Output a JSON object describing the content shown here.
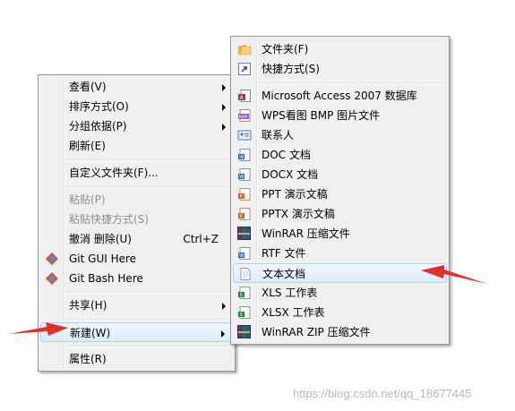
{
  "context_menu": {
    "items": [
      {
        "label": "查看(V)"
      },
      {
        "label": "排序方式(O)"
      },
      {
        "label": "分组依据(P)"
      },
      {
        "label": "刷新(E)"
      },
      {
        "label": "自定义文件夹(F)..."
      },
      {
        "label": "粘贴(P)"
      },
      {
        "label": "粘贴快捷方式(S)"
      },
      {
        "label": "撤消 删除(U)",
        "shortcut": "Ctrl+Z"
      },
      {
        "label": "Git GUI Here"
      },
      {
        "label": "Git Bash Here"
      },
      {
        "label": "共享(H)"
      },
      {
        "label": "新建(W)"
      },
      {
        "label": "属性(R)"
      }
    ]
  },
  "new_submenu": {
    "items": [
      {
        "label": "文件夹(F)",
        "icon": "folder-icon"
      },
      {
        "label": "快捷方式(S)",
        "icon": "shortcut-icon"
      },
      {
        "label": "Microsoft Access 2007 数据库",
        "icon": "access-icon"
      },
      {
        "label": "WPS看图 BMP 图片文件",
        "icon": "bmp-icon"
      },
      {
        "label": "联系人",
        "icon": "contact-icon"
      },
      {
        "label": "DOC 文档",
        "icon": "doc-icon"
      },
      {
        "label": "DOCX 文档",
        "icon": "docx-icon"
      },
      {
        "label": "PPT 演示文稿",
        "icon": "ppt-icon"
      },
      {
        "label": "PPTX 演示文稿",
        "icon": "pptx-icon"
      },
      {
        "label": "WinRAR 压缩文件",
        "icon": "winrar-icon"
      },
      {
        "label": "RTF 文件",
        "icon": "rtf-icon"
      },
      {
        "label": "文本文档",
        "icon": "text-document-icon"
      },
      {
        "label": "XLS 工作表",
        "icon": "xls-icon"
      },
      {
        "label": "XLSX 工作表",
        "icon": "xlsx-icon"
      },
      {
        "label": "WinRAR ZIP 压缩文件",
        "icon": "winrar-zip-icon"
      }
    ]
  },
  "watermark": "https://blog.csdn.net/qq_18677445",
  "colors": {
    "annotation_arrow": "#e0302a",
    "highlight_border": "#aecff7"
  }
}
